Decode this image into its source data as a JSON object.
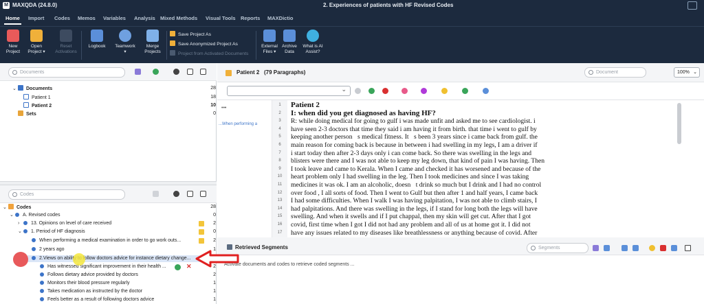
{
  "titlebar": {
    "app_name": "MAXQDA (24.8.0)",
    "doc_title": "2. Experiences of patients with HF Revised Codes"
  },
  "menu": [
    "Home",
    "Import",
    "Codes",
    "Memos",
    "Variables",
    "Analysis",
    "Mixed Methods",
    "Visual Tools",
    "Reports",
    "MAXDictio"
  ],
  "ribbon": {
    "buttons": [
      {
        "label": "New\nProject",
        "color": "#e85a5a"
      },
      {
        "label": "Open\nProject ▾",
        "color": "#f0b03a"
      },
      {
        "label": "Reset\nActivations",
        "color": "#4a5a70"
      },
      {
        "label": "Logbook",
        "color": "#5b8fd9"
      },
      {
        "label": "Teamwork\n▾",
        "color": "#6fa0e0"
      },
      {
        "label": "Merge\nProjects",
        "color": "#7fb0e8"
      },
      {
        "label": "External\nFiles ▾",
        "color": "#5b8fd9"
      },
      {
        "label": "Archive\nData",
        "color": "#5b8fd9"
      },
      {
        "label": "What is AI\nAssist?",
        "color": "#3fb0e0"
      }
    ],
    "small": [
      "Save Project As",
      "Save Anonymized Project As",
      "Project from Activated Documents"
    ]
  },
  "documents_panel": {
    "search_placeholder": "Documents",
    "root": {
      "label": "Documents",
      "count": "28"
    },
    "items": [
      {
        "label": "Patient 1",
        "count": "18"
      },
      {
        "label": "Patient 2",
        "count": "10"
      }
    ],
    "sets": {
      "label": "Sets",
      "count": "0"
    }
  },
  "codes_panel": {
    "search_placeholder": "Codes",
    "root": {
      "label": "Codes",
      "count": "28"
    },
    "rows": [
      {
        "label": "A. Revised codes",
        "count": "0"
      },
      {
        "label": "13. Opinions on level of care received",
        "count": "2"
      },
      {
        "label": "1. Period of HF diagnosis",
        "count": "0"
      },
      {
        "label": "When performing a medical examination in order to go work outs...",
        "count": "2"
      },
      {
        "label": "2 years ago",
        "count": "1"
      },
      {
        "label": "2.Views on ability to follow doctors advice for instance dietary change...",
        "count": "0"
      },
      {
        "label": "Has witnessed significant improvement in their health ...",
        "count": "2"
      },
      {
        "label": "Follows dietary advice provided by doctors",
        "count": "2"
      },
      {
        "label": "Monitors their blood pressure regularly",
        "count": "1"
      },
      {
        "label": "Takes medication as instructed by the doctor",
        "count": "1"
      },
      {
        "label": "Feels better as a result of following doctors advice",
        "count": "1"
      }
    ]
  },
  "document_browser": {
    "title": "Patient 2",
    "paragraphs": "(79 Paragraphs)",
    "search_placeholder": "Document",
    "zoom": "100%",
    "memo_label": "...When performing a",
    "memo_dots": "•••",
    "lines": [
      {
        "n": "1",
        "text": "Patient 2"
      },
      {
        "n": "2",
        "text": "I: when did you get diagnosed as having HF?"
      },
      {
        "n": "3",
        "text": "R: while doing medical for going to gulf i was made unfit and asked me to see cardiologist. i"
      },
      {
        "n": "4",
        "text": "have seen 2-3 doctors that time they said i am having it from birth. that time i went to gulf by"
      },
      {
        "n": "5",
        "text": "keeping another person\u0000s medical fitness. It\u0000s been 3 years since i came back from gulf. the"
      },
      {
        "n": "6",
        "text": "main reason for coming back is because in between i had swelling in my legs, I am a driver if"
      },
      {
        "n": "7",
        "text": "i start today then after 2-3 days only i can come back. So there was swelling in the legs and"
      },
      {
        "n": "8",
        "text": "blisters were there and I was not able to keep my leg down, that kind of pain I was having. Then"
      },
      {
        "n": "9",
        "text": "I took leave and came to Kerala. When I came and checked it has worsened and because of the"
      },
      {
        "n": "10",
        "text": "heart problem only I had swelling in the leg. Then I took medicines and since I was taking"
      },
      {
        "n": "11",
        "text": "medicines it was ok. I am an alcoholic, doesn\u0000t drink so much but I drink and I had no control"
      },
      {
        "n": "12",
        "text": "over food , I all sorts of food. Then I went to Gulf but then after 1 and half years, I came back"
      },
      {
        "n": "13",
        "text": "I had some difficulties. When I walk I was having palpitation, I was not able to climb stairs, I"
      },
      {
        "n": "14",
        "text": "had palpitations. And there was swelling in the legs, if I stand for long both the legs will have"
      },
      {
        "n": "15",
        "text": "swelling. And when it swells and if I put chappal, then my skin will get cut. After that I got"
      },
      {
        "n": "16",
        "text": "covid, first time when I got I did not had any problem and all of us at home got it. I did not"
      },
      {
        "n": "17",
        "text": "have any issues related to my diseases like breathlessness or anything because of covid. After"
      }
    ]
  },
  "retrieved_segments": {
    "title": "Retrieved Segments",
    "search_placeholder": "Segments",
    "hint": "Activate documents and codes to retrieve coded segments ..."
  }
}
